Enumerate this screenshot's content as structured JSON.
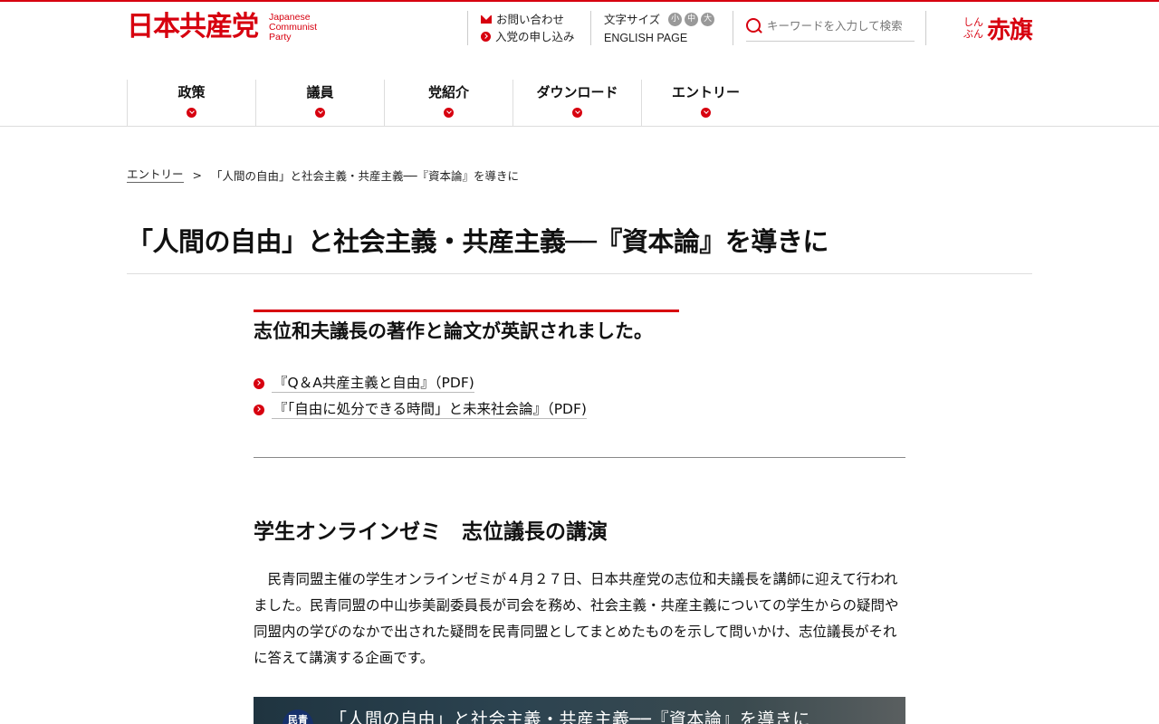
{
  "header": {
    "logo_jp": "日本共産党",
    "logo_en": [
      "Japanese",
      "Communist",
      "Party"
    ],
    "contact_label": "お問い合わせ",
    "join_label": "入党の申し込み",
    "font_size_label": "文字サイズ",
    "font_sizes": [
      "小",
      "中",
      "大"
    ],
    "english_label": "ENGLISH PAGE",
    "search_placeholder": "キーワードを入力して検索",
    "akahata_small": [
      "しん",
      "ぶん"
    ],
    "akahata_large": "赤旗"
  },
  "nav": {
    "items": [
      {
        "label": "政策"
      },
      {
        "label": "議員"
      },
      {
        "label": "党紹介"
      },
      {
        "label": "ダウンロード"
      },
      {
        "label": "エントリー"
      }
    ]
  },
  "breadcrumb": {
    "parent": "エントリー",
    "separator": ">",
    "current": "「人間の自由」と社会主義・共産主義──『資本論』を導きに"
  },
  "page": {
    "title": "「人間の自由」と社会主義・共産主義──『資本論』を導きに"
  },
  "section1": {
    "heading": "志位和夫議長の著作と論文が英訳されました。",
    "links": [
      {
        "label": "『Q＆A共産主義と自由』（PDF)"
      },
      {
        "label": "『「自由に処分できる時間」と未来社会論』（PDF)"
      }
    ]
  },
  "section2": {
    "heading": "学生オンラインゼミ　志位議長の講演",
    "body": "民青同盟主催の学生オンラインゼミが４月２７日、日本共産党の志位和夫議長を講師に迎えて行われました。民青同盟の中山歩美副委員長が司会を務め、社会主義・共産主義についての学生からの疑問や同盟内の学びのなかで出された疑問を民青同盟としてまとめたものを示して問いかけ、志位議長がそれに答えて講演する企画です。"
  },
  "video": {
    "badge": "民青",
    "title": "「人間の自由」と社会主義・共産主義──『資本論』を導きに"
  },
  "colors": {
    "accent": "#d7000f",
    "text": "#111111",
    "divider": "#dddddd"
  }
}
